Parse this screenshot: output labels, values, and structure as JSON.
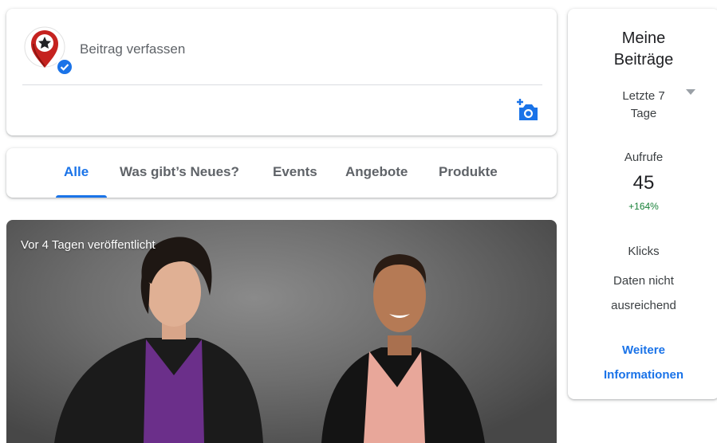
{
  "compose": {
    "placeholder": "Beitrag verfassen",
    "avatar_icon": "map-pin-star-icon",
    "verified_icon": "verified-check-icon",
    "photo_icon": "add-photo-camera-icon"
  },
  "tabs": [
    {
      "label": "Alle",
      "active": true
    },
    {
      "label": "Was gibt’s Neues?",
      "active": false
    },
    {
      "label": "Events",
      "active": false
    },
    {
      "label": "Angebote",
      "active": false
    },
    {
      "label": "Produkte",
      "active": false
    }
  ],
  "post": {
    "published": "Vor 4 Tagen veröffentlicht"
  },
  "sidebar": {
    "title": "Meine Beiträge",
    "range": "Letzte 7 Tage",
    "views_label": "Aufrufe",
    "views_value": "45",
    "views_change": "+164%",
    "clicks_label": "Klicks",
    "clicks_value": "Daten nicht ausreichend",
    "more_link": "Weitere Informationen"
  },
  "colors": {
    "accent": "#1a73e8",
    "positive": "#188038",
    "brand_red": "#c5221f"
  }
}
